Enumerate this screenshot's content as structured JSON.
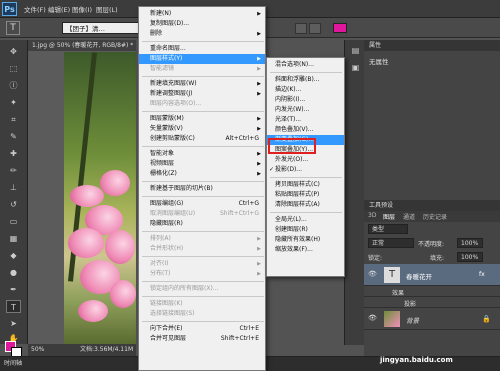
{
  "app": {
    "logo": "Ps"
  },
  "menubar": [
    "文件(F)",
    "编辑(E)",
    "图像(I)",
    "图层(L)"
  ],
  "options": {
    "font_family": "【团子】清…",
    "color": "#e0169c"
  },
  "document": {
    "tab_title": "1.jpg @ 50% (春暖花开, RGB/8#) *",
    "zoom": "50%",
    "doc_info": "文档:3.56M/4.11M"
  },
  "bottom": {
    "timeline": "时间轴"
  },
  "layer_menu": [
    {
      "label": "新建(N)",
      "arrow": true
    },
    {
      "label": "复制图层(D)..."
    },
    {
      "label": "删除",
      "arrow": true
    },
    {
      "sep": true
    },
    {
      "label": "重命名图层..."
    },
    {
      "label": "图层样式(Y)",
      "arrow": true,
      "hl": true
    },
    {
      "label": "智能滤镜",
      "arrow": true,
      "dis": true
    },
    {
      "sep": true
    },
    {
      "label": "新建填充图层(W)",
      "arrow": true
    },
    {
      "label": "新建调整图层(J)",
      "arrow": true
    },
    {
      "label": "图层内容选项(O)...",
      "dis": true
    },
    {
      "sep": true
    },
    {
      "label": "图层蒙版(M)",
      "arrow": true
    },
    {
      "label": "矢量蒙版(V)",
      "arrow": true
    },
    {
      "label": "创建剪贴蒙版(C)",
      "shortcut": "Alt+Ctrl+G"
    },
    {
      "sep": true
    },
    {
      "label": "智能对象",
      "arrow": true
    },
    {
      "label": "视频图层",
      "arrow": true
    },
    {
      "label": "栅格化(Z)",
      "arrow": true
    },
    {
      "sep": true
    },
    {
      "label": "新建基于图层的切片(B)"
    },
    {
      "sep": true
    },
    {
      "label": "图层编组(G)",
      "shortcut": "Ctrl+G"
    },
    {
      "label": "取消图层编组(U)",
      "shortcut": "Shift+Ctrl+G",
      "dis": true
    },
    {
      "label": "隐藏图层(R)"
    },
    {
      "sep": true
    },
    {
      "label": "排列(A)",
      "arrow": true,
      "dis": true
    },
    {
      "label": "合并形状(H)",
      "arrow": true,
      "dis": true
    },
    {
      "sep": true
    },
    {
      "label": "对齐(I)",
      "arrow": true,
      "dis": true
    },
    {
      "label": "分布(T)",
      "arrow": true,
      "dis": true
    },
    {
      "sep": true
    },
    {
      "label": "锁定组内的所有图层(X)...",
      "dis": true
    },
    {
      "sep": true
    },
    {
      "label": "链接图层(K)",
      "dis": true
    },
    {
      "label": "选择链接图层(S)",
      "dis": true
    },
    {
      "sep": true
    },
    {
      "label": "向下合并(E)",
      "shortcut": "Ctrl+E"
    },
    {
      "label": "合并可见图层",
      "shortcut": "Shift+Ctrl+E"
    }
  ],
  "style_submenu": [
    {
      "label": "混合选项(N)..."
    },
    {
      "sep": true
    },
    {
      "label": "斜面和浮雕(B)..."
    },
    {
      "label": "描边(K)..."
    },
    {
      "label": "内阴影(I)..."
    },
    {
      "label": "内发光(W)..."
    },
    {
      "label": "光泽(T)..."
    },
    {
      "label": "颜色叠加(V)..."
    },
    {
      "label": "渐变叠加(G)...",
      "hl": true
    },
    {
      "label": "图案叠加(Y)..."
    },
    {
      "label": "外发光(O)..."
    },
    {
      "label": "投影(D)...",
      "check": true
    },
    {
      "sep": true
    },
    {
      "label": "拷贝图层样式(C)"
    },
    {
      "label": "粘贴图层样式(P)"
    },
    {
      "label": "清除图层样式(A)"
    },
    {
      "sep": true
    },
    {
      "label": "全局光(L)..."
    },
    {
      "label": "创建图层(R)"
    },
    {
      "label": "隐藏所有效果(H)"
    },
    {
      "label": "缩放效果(F)..."
    }
  ],
  "properties": {
    "title": "属性",
    "content": "无属性"
  },
  "layers_panel": {
    "title": "工具预设",
    "tabs": [
      "3D",
      "图层",
      "通道",
      "历史记录"
    ],
    "filter": "类型",
    "blend_mode": "正常",
    "opacity_label": "不透明度:",
    "opacity": "100%",
    "lock_label": "锁定:",
    "fill_label": "填充:",
    "fill": "100%",
    "layers": [
      {
        "name": "春暖花开",
        "type": "text",
        "fx": "fx"
      },
      {
        "name": "效果",
        "sub": true
      },
      {
        "name": "投影",
        "sub": true
      },
      {
        "name": "背景",
        "type": "image"
      }
    ]
  },
  "watermark": "jingyan.baidu.com"
}
